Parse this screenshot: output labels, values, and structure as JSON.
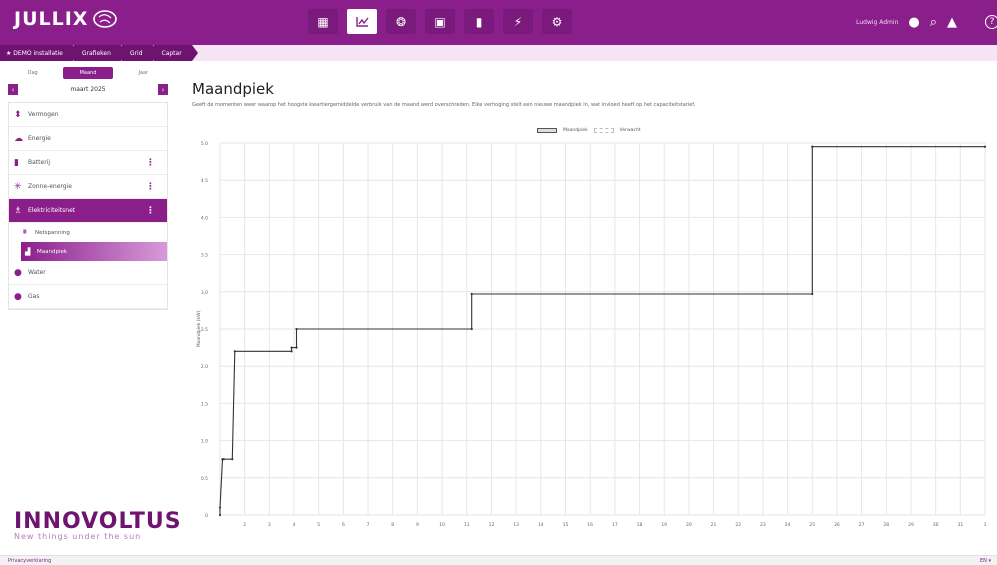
{
  "app": {
    "logo_text": "JULLIX"
  },
  "topnav": {
    "icons": [
      "dashboard-icon",
      "chart-icon",
      "brain-icon",
      "money-icon",
      "battery-icon",
      "plug-icon",
      "gear-icon"
    ],
    "active_index": 1,
    "user_name": "Ludwig Admin"
  },
  "breadcrumb": [
    "DEMO installatie",
    "Grafieken",
    "Grid",
    "Captar"
  ],
  "period": {
    "tabs": [
      "Dag",
      "Maand",
      "Jaar"
    ],
    "active": "Maand",
    "current": "maart 2025"
  },
  "sidebar": {
    "items": [
      {
        "label": "Vermogen",
        "icon": "plus-minus-icon",
        "menu": false
      },
      {
        "label": "Energie",
        "icon": "cloud-icon",
        "menu": false
      },
      {
        "label": "Batterij",
        "icon": "battery-icon",
        "menu": true
      },
      {
        "label": "Zonne-energie",
        "icon": "sun-icon",
        "menu": true
      },
      {
        "label": "Elektriciteitsnet",
        "icon": "pylon-icon",
        "menu": true,
        "active": true
      }
    ],
    "subitems": [
      {
        "label": "Netspanning",
        "icon": "voltage-icon"
      },
      {
        "label": "Maandpiek",
        "icon": "peak-icon",
        "active": true
      }
    ],
    "items_after": [
      {
        "label": "Water",
        "icon": "water-icon"
      },
      {
        "label": "Gas",
        "icon": "flame-icon"
      }
    ]
  },
  "brand": {
    "name": "INNOVOLTUS",
    "tagline": "New things under the sun"
  },
  "page": {
    "title": "Maandpiek",
    "description": "Geeft de momenten weer waarop het hoogste kwartiergemiddelde verbruik van de maand werd overschreden. Elke verhoging stelt een nieuwe maandpiek in, wat invloed heeft op het capaciteitstarief."
  },
  "chart_data": {
    "type": "line",
    "series": [
      {
        "name": "Maandpiek",
        "x": [
          1.0,
          1.0,
          1.1,
          1.15,
          1.5,
          1.6,
          3.9,
          3.9,
          4.1,
          4.1,
          11.2,
          11.2,
          25.0,
          25.0,
          32.0
        ],
        "y": [
          0.0,
          0.1,
          0.75,
          0.75,
          0.75,
          2.2,
          2.2,
          2.25,
          2.25,
          2.5,
          2.5,
          2.97,
          2.97,
          4.95,
          4.95
        ]
      },
      {
        "name": "Verwacht",
        "x": [],
        "y": []
      }
    ],
    "xticks": [
      "2",
      "3",
      "4",
      "5",
      "6",
      "7",
      "8",
      "9",
      "10",
      "11",
      "12",
      "13",
      "14",
      "15",
      "16",
      "17",
      "18",
      "19",
      "20",
      "21",
      "22",
      "23",
      "24",
      "25",
      "26",
      "27",
      "28",
      "29",
      "30",
      "31",
      "1"
    ],
    "yticks": [
      "0",
      "0.5",
      "1.0",
      "1.5",
      "2.0",
      "2.5",
      "3.0",
      "3.5",
      "4.0",
      "4.5",
      "5.0"
    ],
    "xlim": [
      1,
      32
    ],
    "ylim": [
      0,
      5
    ],
    "ylabel": "Maandpiek (kW)",
    "grid": true,
    "legend": "top-center"
  },
  "footer": {
    "left": "Privacyverklaring",
    "right": "EN ▾"
  }
}
